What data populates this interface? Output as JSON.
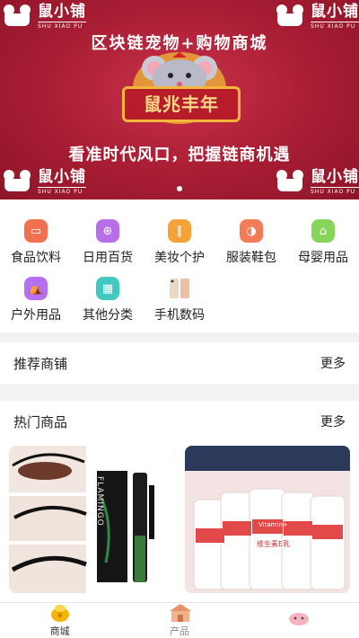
{
  "banner": {
    "brand_name": "鼠小铺",
    "brand_sub": "SHU XIAO PU",
    "headline": "区块链宠物+购物商城",
    "sign_text": "鼠兆丰年",
    "slogan": "看准时代风口，把握链商机遇",
    "active_slide": 1
  },
  "categories": [
    {
      "label": "食品饮料",
      "icon": "drink-icon",
      "color": "#f07050"
    },
    {
      "label": "日用百货",
      "icon": "daily-goods-icon",
      "color": "#b66fe8"
    },
    {
      "label": "美妆个护",
      "icon": "makeup-icon",
      "color": "#f5a23a"
    },
    {
      "label": "服装鞋包",
      "icon": "clothing-icon",
      "color": "#f37b58"
    },
    {
      "label": "母婴用品",
      "icon": "baby-icon",
      "color": "#86d45a"
    },
    {
      "label": "户外用品",
      "icon": "outdoor-icon",
      "color": "#b470f0"
    },
    {
      "label": "其他分类",
      "icon": "grid-icon",
      "color": "#42c7c1"
    },
    {
      "label": "手机数码",
      "icon": "phone-icon",
      "color": "#d9c9b8"
    }
  ],
  "recommended": {
    "title": "推荐商铺",
    "more": "更多"
  },
  "hot": {
    "title": "热门商品",
    "more": "更多"
  },
  "products": [
    {
      "image_text": "FLAMINGO",
      "icon": "mascara-icon"
    },
    {
      "image_text": "维生素E乳",
      "image_text_en": "Vitamin+",
      "icon": "lotion-icon"
    }
  ],
  "tabs": [
    {
      "label": "商城",
      "icon": "mall-icon",
      "active": true,
      "color": "#e5a100"
    },
    {
      "label": "产品",
      "icon": "product-icon",
      "active": false,
      "color": "#888888"
    },
    {
      "label": "",
      "icon": "pet-icon",
      "active": false,
      "color": "#888888"
    }
  ]
}
